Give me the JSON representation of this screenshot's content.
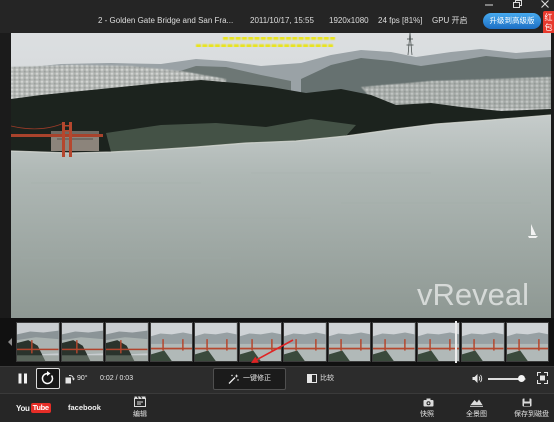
{
  "window": {
    "minimize_icon": "minimize-icon",
    "restore_icon": "restore-icon",
    "close_icon": "close-icon"
  },
  "info_bar": {
    "title": "2 - Golden Gate Bridge and San Fra...",
    "datetime": "2011/10/17, 15:55",
    "resolution": "1920x1080",
    "fps": "24 fps [81%]",
    "gpu": "GPU 开启",
    "upgrade_button": "升级到高级版",
    "red_packet_badge": "红包"
  },
  "video": {
    "watermark": "vReveal"
  },
  "filmstrip": {
    "scroll_left_icon": "triangle-left-icon"
  },
  "playback": {
    "pause_icon": "pause-icon",
    "loop_icon": "loop-icon",
    "rotate_icon": "rotate-icon",
    "rotate_label": "90°",
    "time": "0:02 / 0:03",
    "autofix_icon": "magic-wand-icon",
    "autofix_label": "一键修正",
    "compare_icon": "compare-icon",
    "compare_label": "比较",
    "volume_icon": "speaker-icon",
    "volume_level": 0.88,
    "fullscreen_icon": "fullscreen-icon"
  },
  "toolbar": {
    "youtube_logo": {
      "you": "You",
      "tube": "Tube"
    },
    "facebook": "facebook",
    "edit": {
      "icon": "film-edit-icon",
      "label": "编辑"
    },
    "snapshot": {
      "icon": "camera-icon",
      "label": "快照"
    },
    "panorama": {
      "icon": "panorama-icon",
      "label": "全景图"
    },
    "save": {
      "icon": "disk-icon",
      "label": "保存到磁盘"
    }
  },
  "colors": {
    "chrome": "#262626",
    "upgrade_button": "#2a86d3",
    "badge": "#e8392d",
    "annotation_arrow": "#e02424",
    "youtube_red": "#e52d27",
    "subtitle_yellow": "#e9e41a"
  }
}
